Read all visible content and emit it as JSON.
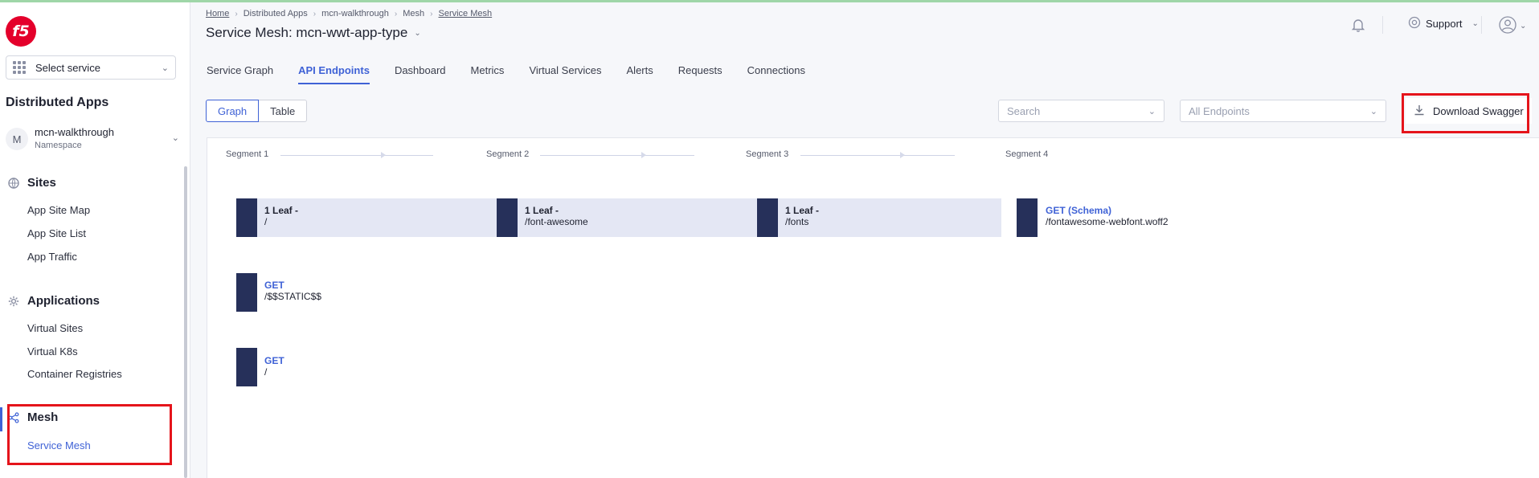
{
  "sidebar": {
    "logo_text": "f5",
    "service_select": "Select service",
    "title": "Distributed Apps",
    "namespace": {
      "avatar": "M",
      "name": "mcn-walkthrough",
      "label": "Namespace"
    },
    "sections": [
      {
        "title": "Sites",
        "icon": "globe-icon",
        "items": [
          "App Site Map",
          "App Site List",
          "App Traffic"
        ]
      },
      {
        "title": "Applications",
        "icon": "gear-icon",
        "items": [
          "Virtual Sites",
          "Virtual K8s",
          "Container Registries"
        ]
      },
      {
        "title": "Mesh",
        "icon": "share-icon",
        "items": [
          "Service Mesh"
        ]
      }
    ]
  },
  "header": {
    "breadcrumb": [
      "Home",
      "Distributed Apps",
      "mcn-walkthrough",
      "Mesh",
      "Service Mesh"
    ],
    "title": "Service Mesh: mcn-wwt-app-type",
    "support": "Support"
  },
  "tabs": [
    "Service Graph",
    "API Endpoints",
    "Dashboard",
    "Metrics",
    "Virtual Services",
    "Alerts",
    "Requests",
    "Connections"
  ],
  "view_toggle": {
    "graph": "Graph",
    "table": "Table"
  },
  "filters": {
    "search_placeholder": "Search",
    "endpoints": "All Endpoints"
  },
  "download_label": "Download Swagger",
  "graph": {
    "segments": [
      "Segment 1",
      "Segment 2",
      "Segment 3",
      "Segment 4"
    ],
    "rows": [
      [
        {
          "method": "1 Leaf -",
          "path": "/"
        },
        {
          "method": "1 Leaf -",
          "path": "/font-awesome"
        },
        {
          "method": "1 Leaf -",
          "path": "/fonts"
        },
        {
          "method": "GET (Schema)",
          "path": "/fontawesome-webfont.woff2"
        }
      ],
      [
        {
          "method": "GET",
          "path": "/$$STATIC$$"
        }
      ],
      [
        {
          "method": "GET",
          "path": "/"
        }
      ]
    ]
  },
  "colors": {
    "accent": "#3f62d6",
    "node_dark": "#26305a",
    "node_light": "#e4e7f4",
    "highlight": "#e5141b",
    "brand": "#e4002b"
  }
}
